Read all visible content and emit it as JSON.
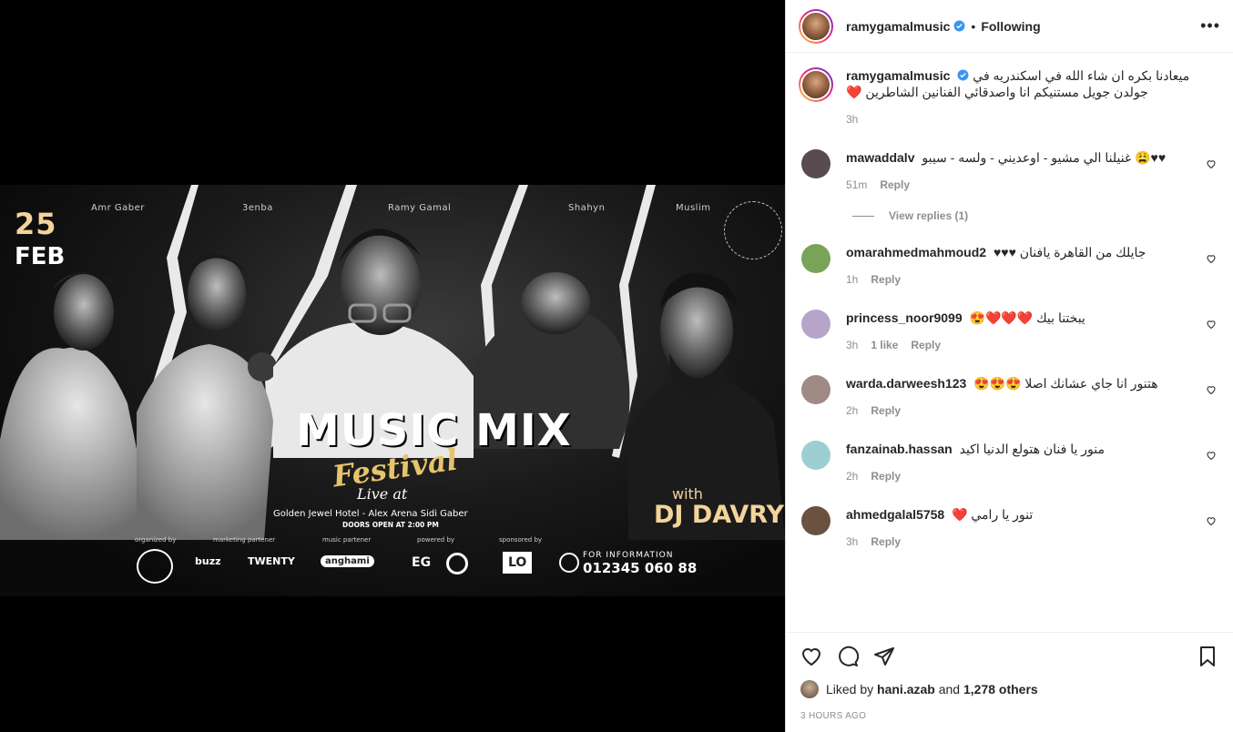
{
  "poster": {
    "artists": [
      "Amr Gaber",
      "3enba",
      "Ramy Gamal",
      "Shahyn",
      "Muslim"
    ],
    "date_day": "25",
    "date_month": "FEB",
    "festival_title": "MUSIC MIX",
    "festival_sub": "Festival",
    "festival_live": "Live at",
    "venue": "Golden Jewel Hotel - Alex Arena Sidi Gaber",
    "doors": "DOORS OPEN AT 2:00 PM",
    "with": "with",
    "dj": "DJ DAVRY",
    "labels": {
      "organized": "organized by",
      "marketing": "marketing partener",
      "music": "music partener",
      "powered": "powered by",
      "sponsored": "sponsored by"
    },
    "logos": {
      "buzz": "buzz",
      "twenty": "TWENTY",
      "anghami": "anghami",
      "eg": "EG",
      "lo": "LO"
    },
    "info_label": "FOR INFORMATION",
    "info_phone": "012345 060 88"
  },
  "header": {
    "username": "ramygamalmusic",
    "dot": "•",
    "follow": "Following",
    "more": "•••"
  },
  "caption": {
    "username": "ramygamalmusic",
    "text": "ميعادنا بكره ان شاء الله في اسكندريه في جولدن جويل مستنيكم انا واصدقائي الفنانين الشاطرين ❤️",
    "time": "3h"
  },
  "comments": [
    {
      "username": "mawaddalv",
      "text": "♥♥😩 غنيلنا الي مشيو - اوعديني - ولسه - سيبو",
      "time": "51m",
      "likes": "",
      "reply": "Reply",
      "avatar_color": "#5a4a52"
    },
    {
      "username": "omarahmedmahmoud2",
      "text": "جايلك من القاهرة يافنان ♥♥♥",
      "time": "1h",
      "likes": "",
      "reply": "Reply",
      "avatar_color": "#7aa35a"
    },
    {
      "username": "princess_noor9099",
      "text": "يبختنا بيك ❤️❤️❤️😍",
      "time": "3h",
      "likes": "1 like",
      "reply": "Reply",
      "avatar_color": "#b7a4c9"
    },
    {
      "username": "warda.darweesh123",
      "text": "هتنور انا جاي عشانك اصلا 😍😍😍",
      "time": "2h",
      "likes": "",
      "reply": "Reply",
      "avatar_color": "#a08a86"
    },
    {
      "username": "fanzainab.hassan",
      "text": "منور يا فنان هتولع الدنيا اكيد",
      "time": "2h",
      "likes": "",
      "reply": "Reply",
      "avatar_color": "#9bcfd1"
    },
    {
      "username": "ahmedgalal5758",
      "text": "تنور يا رامي ❤️",
      "time": "3h",
      "likes": "",
      "reply": "Reply",
      "avatar_color": "#6b5140"
    }
  ],
  "view_replies": "View replies (1)",
  "likes": {
    "prefix": "Liked by",
    "user": "hani.azab",
    "and": "and",
    "others": "1,278 others"
  },
  "time_ago": "3 HOURS AGO"
}
